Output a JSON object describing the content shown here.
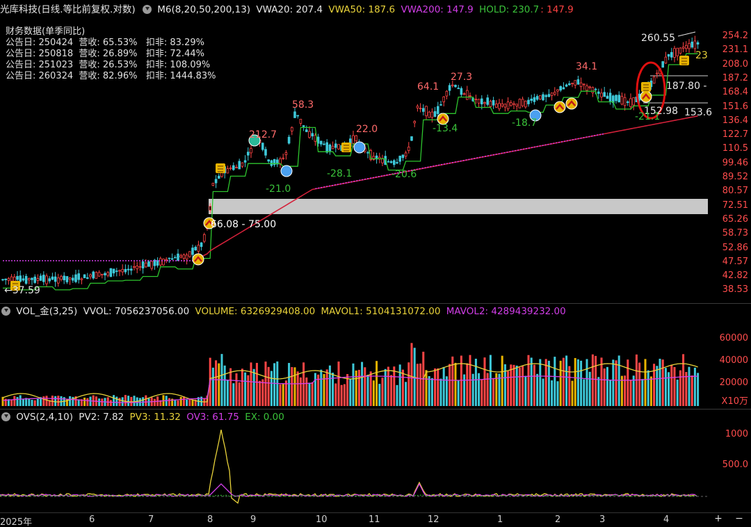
{
  "main_header": {
    "title": "光库科技(日线.等比前复权.对数)",
    "m6": "M6(8,20,50,200,13)",
    "vwa20": "VWA20: 207.4",
    "vwa50": "VWA50: 187.6",
    "vwa200": "VWA200: 147.9",
    "hold_label": "HOLD: 230.7",
    "hold_red": "147.9"
  },
  "financials": {
    "title": "财务数据(单季同比)",
    "rows": [
      "公告日: 250424  营收: 65.53%   扣非: 83.29%",
      "公告日: 250818  营收: 26.89%   扣非: 72.44%",
      "公告日: 251023  营收: 26.53%   扣非: 108.09%",
      "公告日: 260324  营收: 82.96%   扣非: 1444.83%"
    ]
  },
  "price_axis": [
    "254.2",
    "231.1",
    "208.0",
    "187.2",
    "168.4",
    "151.6",
    "136.4",
    "122.7",
    "110.5",
    "99.46",
    "89.52",
    "80.57",
    "72.51",
    "65.26",
    "58.73",
    "52.86",
    "47.57",
    "42.82",
    "38.53"
  ],
  "annotations": {
    "high_label": "260.55",
    "low_label": "37.59",
    "range_label": "66.08 - 75.00",
    "level_187": "187.80 -",
    "level_153": "153.6",
    "level_152": "152.98",
    "partial_23": "23",
    "peaks": [
      "212.7",
      "58.3",
      "22.0",
      "64.1",
      "27.3",
      "34.1"
    ],
    "troughs": [
      "-21.0",
      "-28.1",
      "-20.6",
      "-13.4",
      "-18.7",
      "-21.1"
    ]
  },
  "volume_header": {
    "name": "VOL_金(3,25)",
    "vvol": "VVOL: 7056237056.00",
    "volume": "VOLUME: 6326929408.00",
    "mavol1": "MAVOL1: 5104131072.00",
    "mavol2": "MAVOL2: 4289439232.00"
  },
  "volume_axis": [
    "60000",
    "40000",
    "20000"
  ],
  "volume_unit": "X10万",
  "ovs_header": {
    "name": "OVS(2,4,10)",
    "pv2": "PV2: 7.82",
    "pv3": "PV3: 11.32",
    "ov3": "OV3: 61.75",
    "ex": "EX: 0.00"
  },
  "ovs_axis": [
    "1000",
    "500.0"
  ],
  "x_axis": {
    "labels": [
      "2025年",
      "6",
      "7",
      "8",
      "9",
      "10",
      "11",
      "12",
      "1",
      "2",
      "3",
      "4"
    ],
    "plus": "+",
    "minus": "−"
  },
  "colors": {
    "up": "#ff4545",
    "down": "#3ec9d9",
    "hold": "#2ec42e",
    "vwa200": "#d23ee8",
    "band": "#c8c8c8",
    "circle": "#e01010"
  }
}
